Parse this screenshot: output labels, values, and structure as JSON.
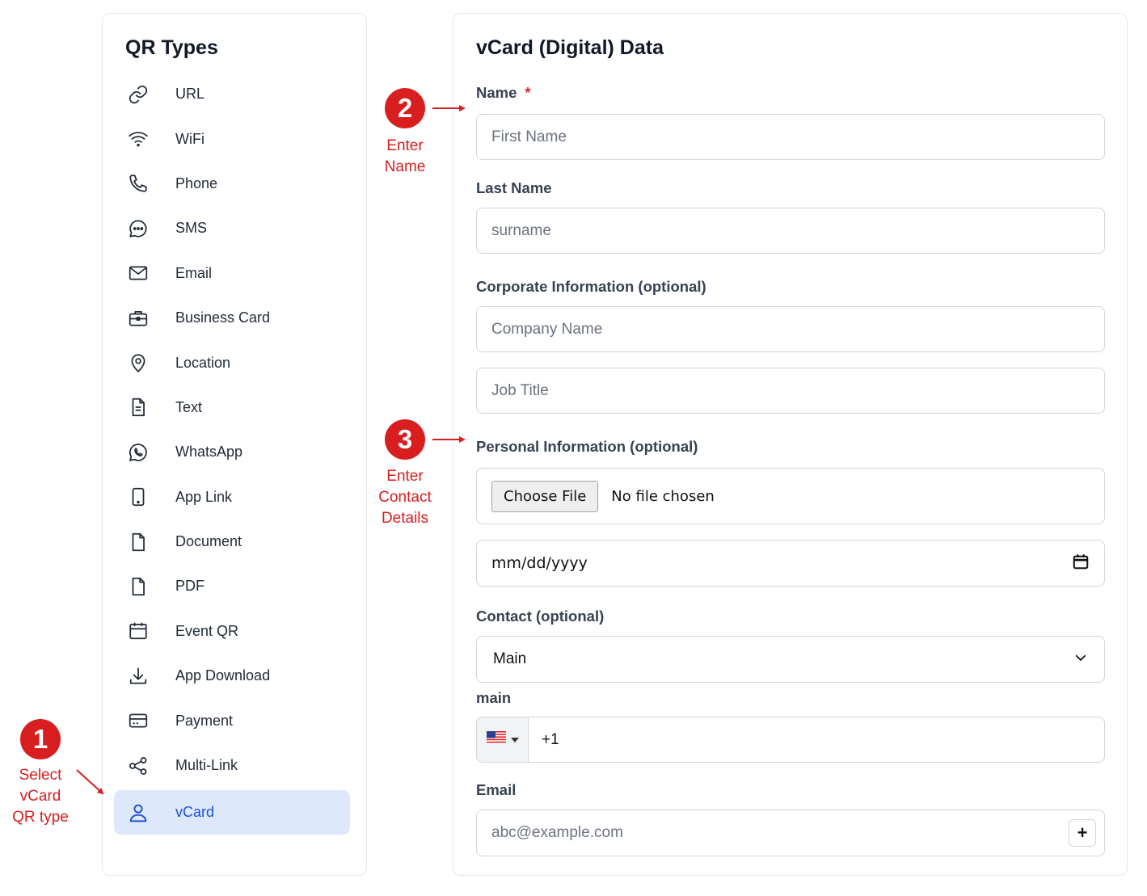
{
  "sidebar": {
    "title": "QR Types",
    "items": [
      {
        "label": "URL",
        "icon": "link-icon"
      },
      {
        "label": "WiFi",
        "icon": "wifi-icon"
      },
      {
        "label": "Phone",
        "icon": "phone-icon"
      },
      {
        "label": "SMS",
        "icon": "sms-icon"
      },
      {
        "label": "Email",
        "icon": "mail-icon"
      },
      {
        "label": "Business Card",
        "icon": "briefcase-icon"
      },
      {
        "label": "Location",
        "icon": "location-pin-icon"
      },
      {
        "label": "Text",
        "icon": "text-file-icon"
      },
      {
        "label": "WhatsApp",
        "icon": "whatsapp-icon"
      },
      {
        "label": "App Link",
        "icon": "smartphone-icon"
      },
      {
        "label": "Document",
        "icon": "document-icon"
      },
      {
        "label": "PDF",
        "icon": "pdf-file-icon"
      },
      {
        "label": "Event QR",
        "icon": "calendar-icon"
      },
      {
        "label": "App Download",
        "icon": "download-icon"
      },
      {
        "label": "Payment",
        "icon": "credit-card-icon"
      },
      {
        "label": "Multi-Link",
        "icon": "share-icon"
      },
      {
        "label": "vCard",
        "icon": "user-icon",
        "active": true
      }
    ]
  },
  "form": {
    "title": "vCard (Digital) Data",
    "name_label": "Name",
    "required_mark": "*",
    "first_name_placeholder": "First Name",
    "last_name_label": "Last Name",
    "last_name_placeholder": "surname",
    "corporate_label": "Corporate Information (optional)",
    "company_placeholder": "Company Name",
    "job_title_placeholder": "Job Title",
    "personal_label": "Personal Information (optional)",
    "choose_file_label": "Choose File",
    "file_status": "No file chosen",
    "date_placeholder": "mm/dd/yyyy",
    "contact_label": "Contact (optional)",
    "contact_select_value": "Main",
    "phone_label": "main",
    "phone_value": "+1",
    "email_label": "Email",
    "email_placeholder": "abc@example.com",
    "add_button": "+"
  },
  "annotations": [
    {
      "number": "1",
      "text_lines": [
        "Select",
        "vCard",
        "QR type"
      ]
    },
    {
      "number": "2",
      "text_lines": [
        "Enter",
        "Name"
      ]
    },
    {
      "number": "3",
      "text_lines": [
        "Enter",
        "Contact",
        "Details"
      ]
    }
  ],
  "colors": {
    "accent": "#1d4ed8",
    "active_bg": "#dde9fb",
    "annotation_red": "#d81e1e",
    "border": "#d1d5db"
  }
}
